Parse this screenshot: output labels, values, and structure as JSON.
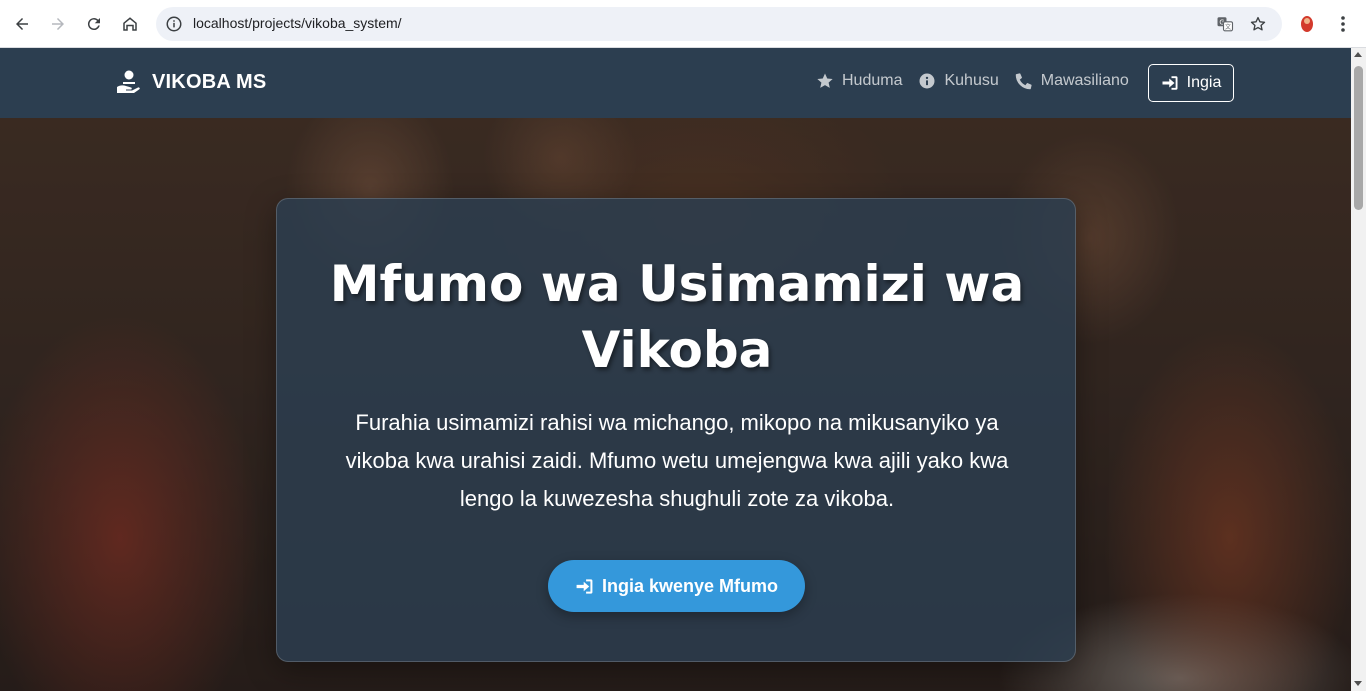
{
  "browser": {
    "url": "localhost/projects/vikoba_system/",
    "icons": [
      "back-icon",
      "forward-icon",
      "reload-icon",
      "home-icon",
      "info-icon",
      "translate-icon",
      "star-icon",
      "profile-icon",
      "more-icon"
    ]
  },
  "navbar": {
    "brand": "VIKOBA MS",
    "links": [
      {
        "label": "Huduma",
        "icon": "star-icon"
      },
      {
        "label": "Kuhusu",
        "icon": "info-circle-icon"
      },
      {
        "label": "Mawasiliano",
        "icon": "phone-icon"
      }
    ],
    "login_label": "Ingia"
  },
  "hero": {
    "title": "Mfumo wa Usimamizi wa Vikoba",
    "description": "Furahia usimamizi rahisi wa michango, mikopo na mikusanyiko ya vikoba kwa urahisi zaidi. Mfumo wetu umejengwa kwa ajili yako kwa lengo la kuwezesha shughuli zote za vikoba.",
    "cta_label": "Ingia kwenye Mfumo"
  },
  "colors": {
    "navbar_bg": "#2c3e50",
    "cta_bg": "#3498db",
    "card_bg": "#2c3e50"
  }
}
